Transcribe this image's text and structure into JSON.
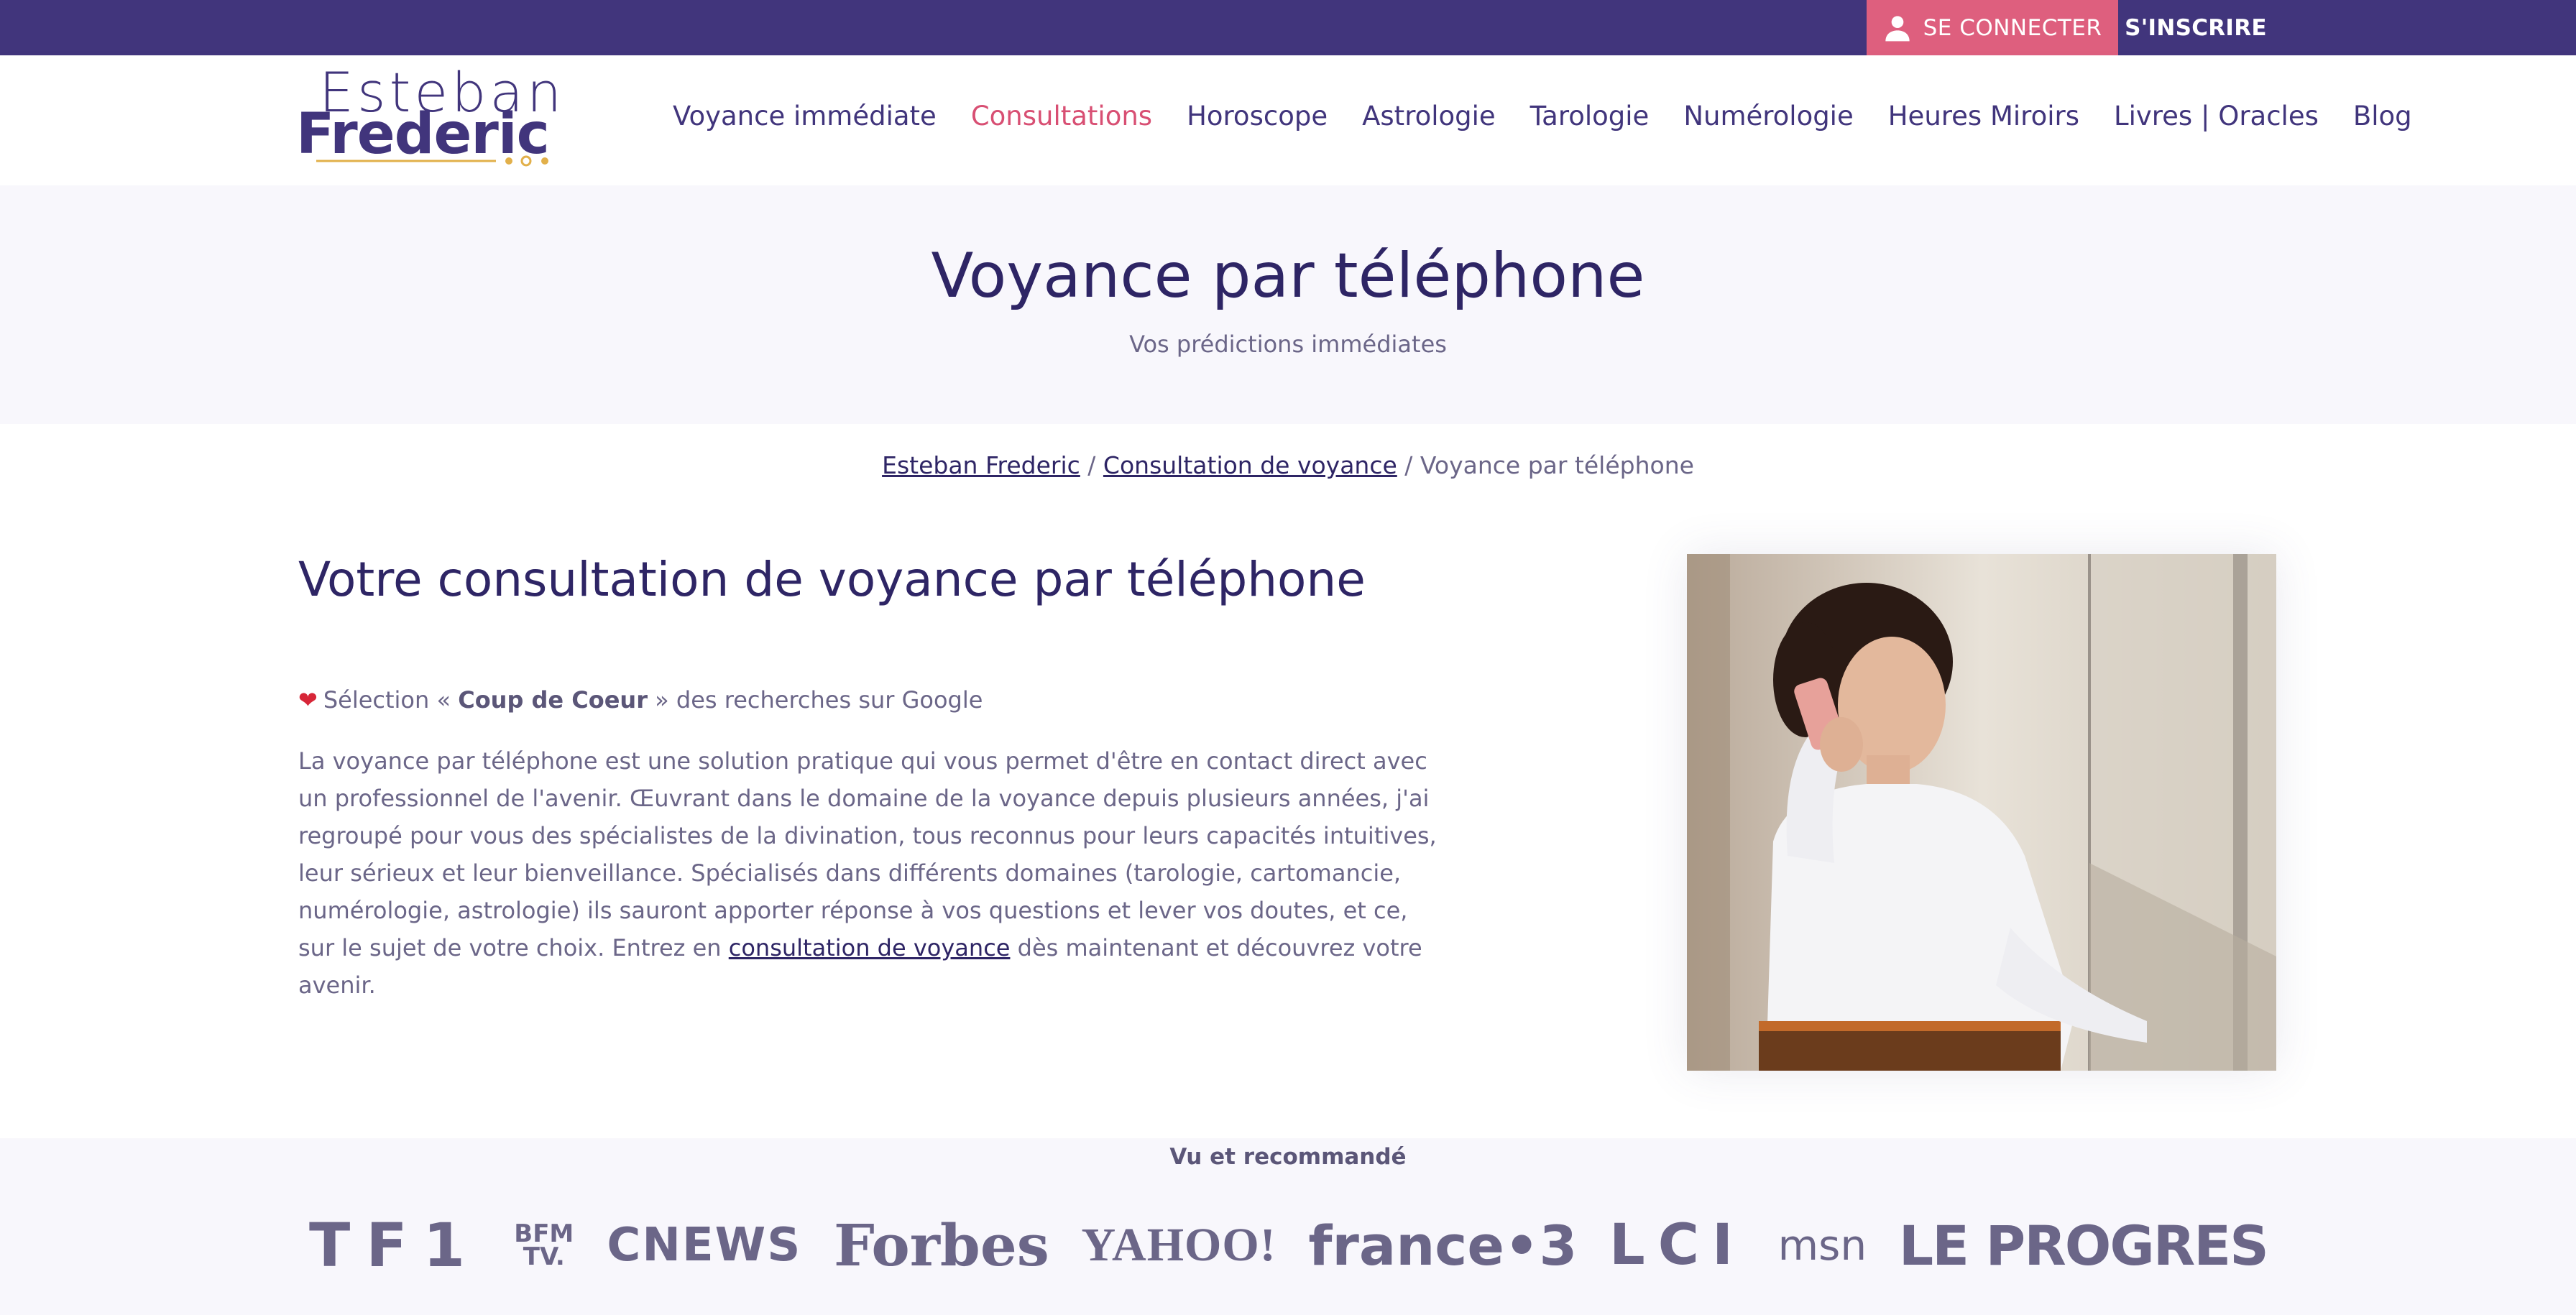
{
  "topbar": {
    "login_label": "SE CONNECTER",
    "signup_label": "S'INSCRIRE"
  },
  "logo": {
    "line1": "Esteban",
    "line2": "Frederic"
  },
  "nav": {
    "items": [
      {
        "label": "Voyance immédiate",
        "active": false
      },
      {
        "label": "Consultations",
        "active": true
      },
      {
        "label": "Horoscope",
        "active": false
      },
      {
        "label": "Astrologie",
        "active": false
      },
      {
        "label": "Tarologie",
        "active": false
      },
      {
        "label": "Numérologie",
        "active": false
      },
      {
        "label": "Heures Miroirs",
        "active": false
      },
      {
        "label": "Livres | Oracles",
        "active": false
      },
      {
        "label": "Blog",
        "active": false
      }
    ]
  },
  "hero": {
    "title": "Voyance par téléphone",
    "subtitle": "Vos prédictions immédiates"
  },
  "breadcrumb": {
    "home": "Esteban Frederic",
    "sep1": " / ",
    "section": "Consultation de voyance",
    "sep2": " / ",
    "current": "Voyance par téléphone"
  },
  "main": {
    "heading": "Votre consultation de voyance par téléphone",
    "pick_prefix": "Sélection « ",
    "pick_bold": "Coup de Coeur",
    "pick_suffix": " » des recherches sur Google",
    "paragraph_text": "La voyance par téléphone est une solution pratique qui vous permet d'être en contact direct avec un professionnel de l'avenir. Œuvrant dans le domaine de la voyance depuis plusieurs années, j'ai regroupé pour vous des spécialistes de la divination, tous reconnus pour leurs capacités intuitives, leur sérieux et leur bienveillance. Spécialisés dans différents domaines (tarologie, cartomancie, numérologie, astrologie) ils sauront apporter réponse à vos questions et lever vos doutes, et ce, sur le sujet de votre choix. Entrez en ",
    "paragraph_link": "consultation de voyance",
    "paragraph_end": " dès maintenant et découvrez votre avenir."
  },
  "press": {
    "title": "Vu et recommandé",
    "logos": [
      "TF1",
      "BFM TV.",
      "CNEWS",
      "Forbes",
      "YAHOO!",
      "france•3",
      "LCI",
      "msn",
      "LE PROGRES"
    ]
  },
  "colors": {
    "brand_purple": "#41357c",
    "accent_pink": "#de5f7e",
    "heading": "#2e2565",
    "text": "#6b6688",
    "hero_bg": "#f8f7fc"
  }
}
